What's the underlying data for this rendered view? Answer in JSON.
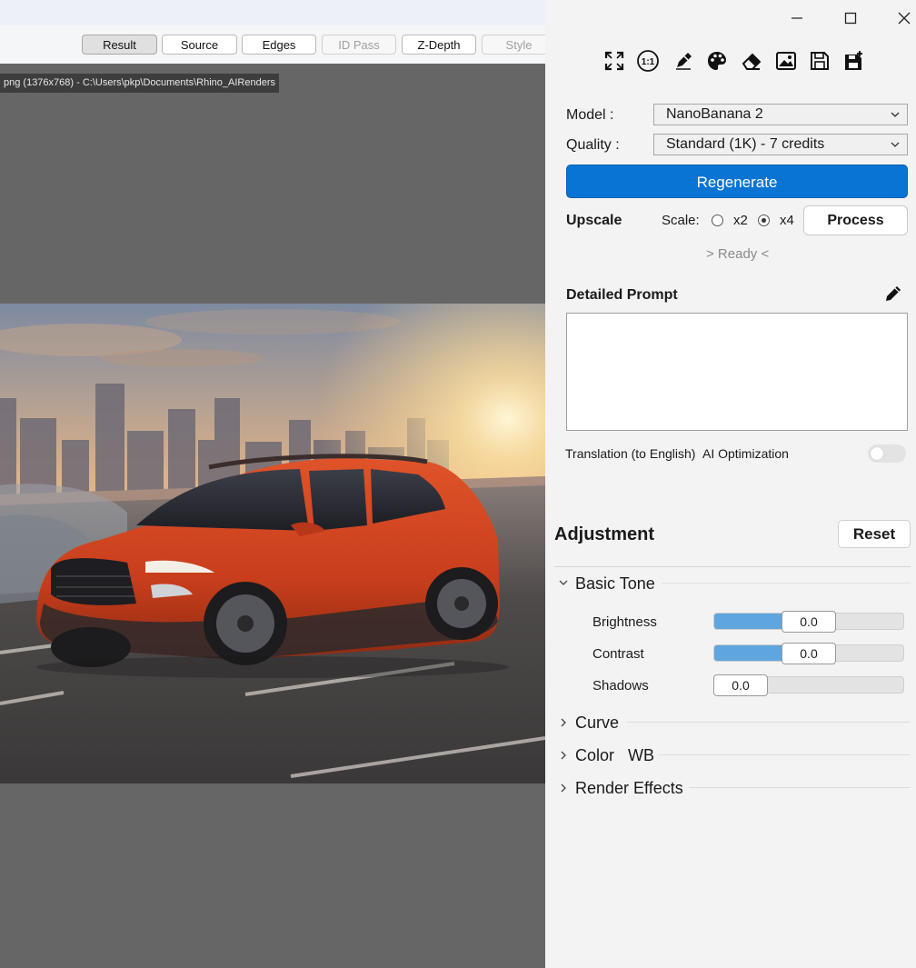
{
  "viewer": {
    "tabs": [
      {
        "label": "Result",
        "state": "active"
      },
      {
        "label": "Source",
        "state": "normal"
      },
      {
        "label": "Edges",
        "state": "normal"
      },
      {
        "label": "ID Pass",
        "state": "disabled"
      },
      {
        "label": "Z-Depth",
        "state": "normal"
      },
      {
        "label": "Style",
        "state": "disabled"
      }
    ],
    "file_info": "png (1376x768) - C:\\Users\\pkp\\Documents\\Rhino_AIRenders"
  },
  "window_controls": {
    "minimize": "minimize-icon",
    "maximize": "maximize-icon",
    "close": "close-icon"
  },
  "toolbar": {
    "tools": [
      "fullscreen-icon",
      "one-to-one-icon",
      "brush-icon",
      "palette-icon",
      "eraser-icon",
      "image-icon",
      "save-icon",
      "save-all-icon"
    ],
    "ratio_text": "1:1"
  },
  "settings": {
    "model_label": "Model :",
    "model_value": "NanoBanana 2",
    "quality_label": "Quality :",
    "quality_value": "Standard (1K) - 7 credits",
    "regenerate_label": "Regenerate",
    "upscale_label": "Upscale",
    "scale_label": "Scale:",
    "scale_options": [
      "x2",
      "x4"
    ],
    "scale_selected": "x4",
    "process_label": "Process",
    "status": "> Ready <"
  },
  "prompt": {
    "title": "Detailed Prompt",
    "text": "",
    "translation_label": "Translation (to English)",
    "ai_optimization_label": "AI Optimization",
    "ai_optimization_on": false
  },
  "adjustment": {
    "title": "Adjustment",
    "reset_label": "Reset",
    "sections": {
      "basic_tone": "Basic Tone",
      "curve": "Curve",
      "color_wb": "Color   WB",
      "render_effects": "Render Effects"
    },
    "sliders": [
      {
        "label": "Brightness",
        "value": "0.0",
        "level": 0.5
      },
      {
        "label": "Contrast",
        "value": "0.0",
        "level": 0.5
      },
      {
        "label": "Shadows",
        "value": "0.0",
        "level": 0.0
      }
    ]
  },
  "colors": {
    "accent": "#0a74d4",
    "slider_fill": "#5fa5de",
    "viewer_bg": "#666666"
  }
}
